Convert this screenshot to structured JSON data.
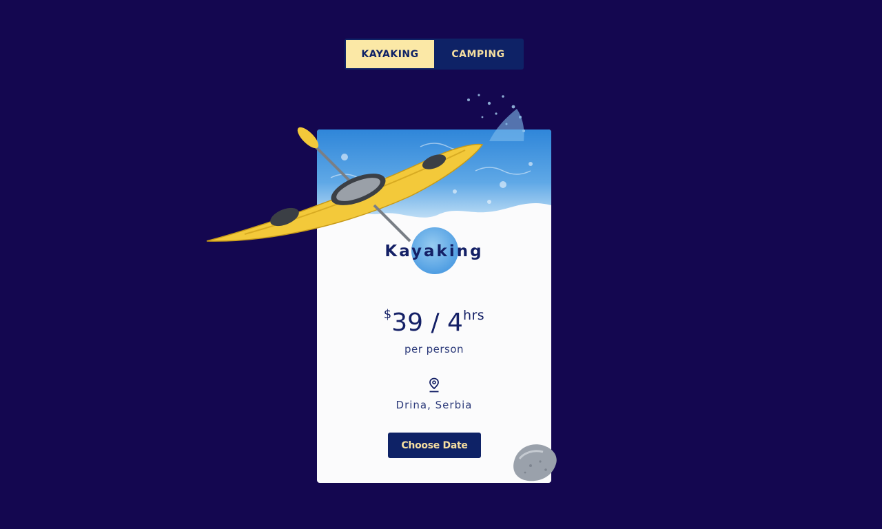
{
  "tabs": [
    {
      "label": "KAYAKING",
      "active": true
    },
    {
      "label": "CAMPING",
      "active": false
    }
  ],
  "card": {
    "title": "Kayaking",
    "price": {
      "currency": "$",
      "amount": "39 / 4",
      "unit": "hrs"
    },
    "per": "per person",
    "location": "Drina, Serbia",
    "cta": "Choose Date"
  },
  "icons": {
    "location": "map-pin-icon"
  },
  "colors": {
    "background": "#140750",
    "navy": "#0e2266",
    "cream": "#fbe8a6",
    "card": "#fbfbfc",
    "kayak_yellow": "#f3c93a",
    "water_blue": "#2f86d9"
  }
}
